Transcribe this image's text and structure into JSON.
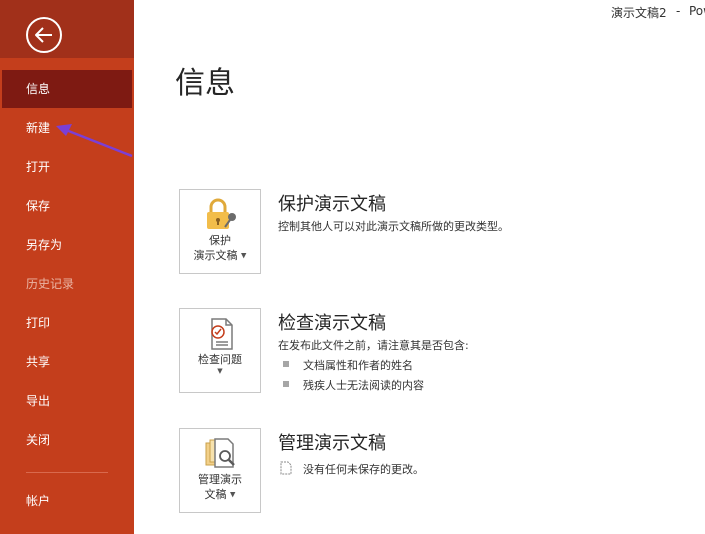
{
  "window": {
    "title": "演示文稿2",
    "separator": "-",
    "app": "Pow"
  },
  "sidebar": {
    "items": [
      {
        "label": "信息"
      },
      {
        "label": "新建"
      },
      {
        "label": "打开"
      },
      {
        "label": "保存"
      },
      {
        "label": "另存为"
      },
      {
        "label": "历史记录"
      },
      {
        "label": "打印"
      },
      {
        "label": "共享"
      },
      {
        "label": "导出"
      },
      {
        "label": "关闭"
      },
      {
        "label": "帐户"
      }
    ]
  },
  "main": {
    "title": "信息",
    "sections": [
      {
        "tile_line1": "保护",
        "tile_line2": "演示文稿",
        "title": "保护演示文稿",
        "desc": "控制其他人可以对此演示文稿所做的更改类型。"
      },
      {
        "tile_line1": "检查问题",
        "title": "检查演示文稿",
        "desc": "在发布此文件之前，请注意其是否包含:",
        "bullets": [
          "文档属性和作者的姓名",
          "残疾人士无法阅读的内容"
        ]
      },
      {
        "tile_line1": "管理演示",
        "tile_line2": "文稿",
        "title": "管理演示文稿",
        "desc": "没有任何未保存的更改。"
      }
    ]
  },
  "colors": {
    "sidebar": "#c43e1c",
    "active": "#7e1a12",
    "annotation": "#7b3fd6"
  }
}
